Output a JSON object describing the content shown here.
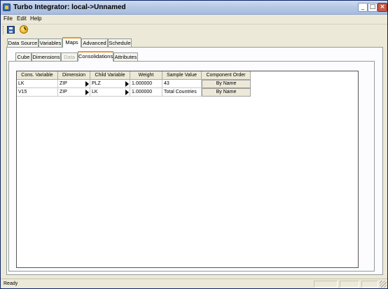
{
  "window": {
    "title": "Turbo Integrator:  local->Unnamed"
  },
  "menu": {
    "items": [
      {
        "label": "File"
      },
      {
        "label": "Edit"
      },
      {
        "label": "Help"
      }
    ]
  },
  "toolbar": {
    "icons": [
      "save-icon",
      "run-icon"
    ]
  },
  "main_tabs": [
    {
      "label": "Data Source",
      "active": false
    },
    {
      "label": "Variables",
      "active": false
    },
    {
      "label": "Maps",
      "active": true
    },
    {
      "label": "Advanced",
      "active": false
    },
    {
      "label": "Schedule",
      "active": false
    }
  ],
  "sub_tabs": [
    {
      "label": "Cube",
      "active": false,
      "disabled": false
    },
    {
      "label": "Dimensions",
      "active": false,
      "disabled": false
    },
    {
      "label": "Data",
      "active": false,
      "disabled": true
    },
    {
      "label": "Consolidations",
      "active": true,
      "disabled": false
    },
    {
      "label": "Attributes",
      "active": false,
      "disabled": false
    }
  ],
  "grid": {
    "headers": [
      "Cons. Variable",
      "Dimension",
      "Child Variable",
      "Weight",
      "Sample Value",
      "Component Order"
    ],
    "rows": [
      {
        "cons_variable": "LK",
        "dimension": "ZIP",
        "child_variable": "PLZ",
        "weight": "1.000000",
        "sample_value": "43",
        "component_order": "By Name"
      },
      {
        "cons_variable": "V15",
        "dimension": "ZIP",
        "child_variable": "LK",
        "weight": "1.000000",
        "sample_value": "Total Countries",
        "component_order": "By Name"
      }
    ]
  },
  "status": {
    "text": "Ready"
  },
  "colors": {
    "active_tab_accent": "#e69c2a",
    "titlebar": "#b7c9e6",
    "window_bg": "#ece9d8"
  }
}
